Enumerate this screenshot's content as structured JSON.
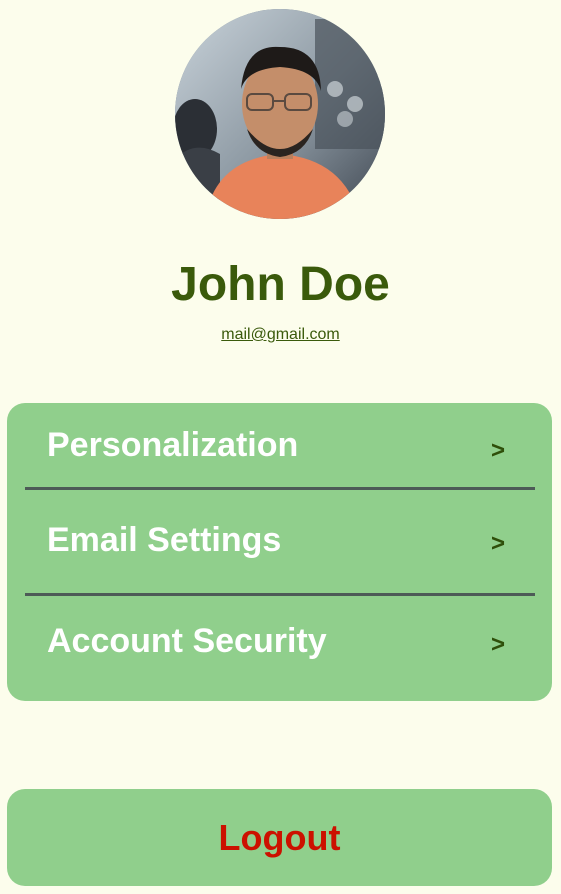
{
  "profile": {
    "name": "John Doe",
    "email": "mail@gmail.com"
  },
  "menu": {
    "items": [
      {
        "label": "Personalization",
        "chevron": ">"
      },
      {
        "label": "Email Settings",
        "chevron": ">"
      },
      {
        "label": "Account Security",
        "chevron": ">"
      }
    ]
  },
  "logout": {
    "label": "Logout"
  },
  "colors": {
    "background": "#fcfdec",
    "card": "#90cf8c",
    "name_text": "#3a5a0b",
    "menu_text": "#ffffff",
    "logout_text": "#cc1100",
    "divider": "#4d5b57"
  }
}
